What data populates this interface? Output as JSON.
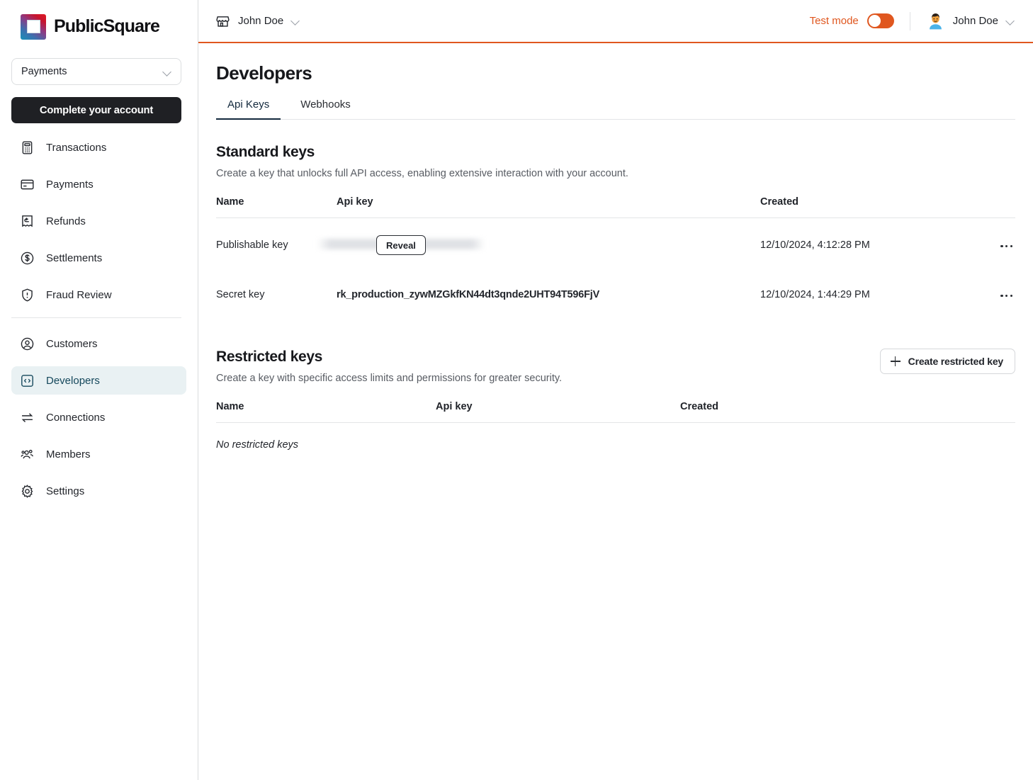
{
  "brand": {
    "name": "PublicSquare",
    "mark": "publicsquare-logo"
  },
  "sidebar": {
    "org_select": {
      "value": "Payments",
      "icon": "chevron-down-icon"
    },
    "cta_label": "Complete your account",
    "items_primary": [
      {
        "label": "Transactions",
        "icon": "calculator-icon"
      },
      {
        "label": "Payments",
        "icon": "credit-card-icon"
      },
      {
        "label": "Refunds",
        "icon": "receipt-refund-icon"
      },
      {
        "label": "Settlements",
        "icon": "dollar-circle-icon"
      },
      {
        "label": "Fraud Review",
        "icon": "shield-alert-icon"
      }
    ],
    "items_secondary": [
      {
        "label": "Customers",
        "icon": "user-circle-icon",
        "active": false
      },
      {
        "label": "Developers",
        "icon": "code-brackets-icon",
        "active": true
      },
      {
        "label": "Connections",
        "icon": "arrows-exchange-icon",
        "active": false
      },
      {
        "label": "Members",
        "icon": "users-group-icon",
        "active": false
      },
      {
        "label": "Settings",
        "icon": "gear-icon",
        "active": false
      }
    ]
  },
  "topbar": {
    "store": {
      "label": "John Doe",
      "icon": "storefront-icon",
      "chevron": "chevron-down-icon"
    },
    "test_mode": {
      "label": "Test mode",
      "enabled": true,
      "color": "#e0571f"
    },
    "user": {
      "name": "John Doe",
      "avatar": "person-avatar",
      "chevron": "chevron-down-icon"
    }
  },
  "page": {
    "title": "Developers",
    "tabs": [
      {
        "label": "Api Keys",
        "active": true
      },
      {
        "label": "Webhooks",
        "active": false
      }
    ]
  },
  "standard_keys": {
    "title": "Standard keys",
    "subtitle": "Create a key that unlocks full API access, enabling extensive interaction with your account.",
    "columns": [
      "Name",
      "Api key",
      "Created",
      ""
    ],
    "rows": [
      {
        "name": "Publishable key",
        "api_key": "",
        "api_key_masked": true,
        "reveal_label": "Reveal",
        "created": "12/10/2024, 4:12:28 PM",
        "menu": "more-options-icon"
      },
      {
        "name": "Secret key",
        "api_key": "rk_production_zywMZGkfKN44dt3qnde2UHT94T596FjV",
        "api_key_masked": false,
        "reveal_label": "",
        "created": "12/10/2024, 1:44:29 PM",
        "menu": "more-options-icon"
      }
    ]
  },
  "restricted_keys": {
    "title": "Restricted keys",
    "subtitle": "Create a key with specific access limits and permissions for greater security.",
    "create_label": "Create restricted key",
    "columns": [
      "Name",
      "Api key",
      "Created"
    ],
    "empty_text": "No restricted keys"
  },
  "colors": {
    "accent_orange": "#e0571f",
    "active_nav_bg": "#e9f1f3",
    "active_nav_fg": "#15485c",
    "tab_underline": "#13293d"
  }
}
